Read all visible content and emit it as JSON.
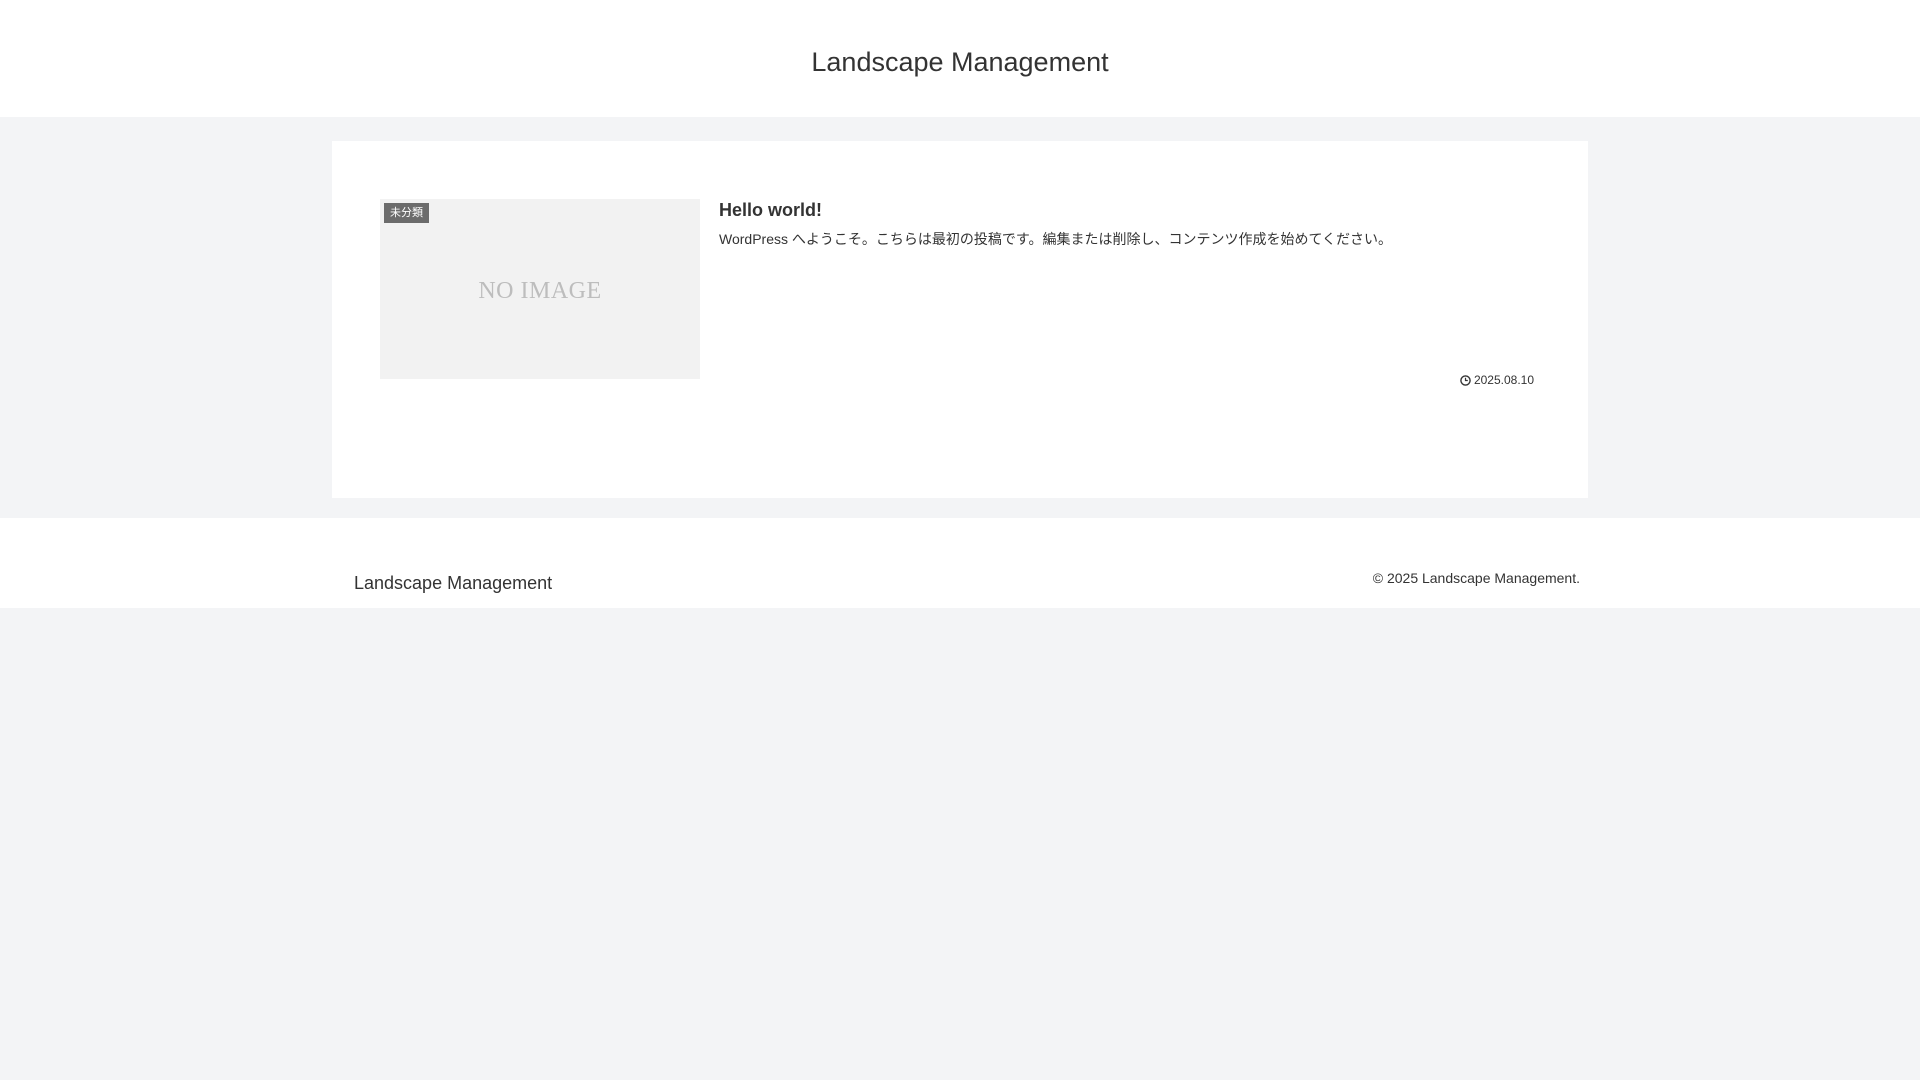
{
  "header": {
    "site_title": "Landscape Management"
  },
  "entry": {
    "thumbnail_text": "NO IMAGE",
    "category": "未分類",
    "title": "Hello world!",
    "snippet": "WordPress へようこそ。こちらは最初の投稿です。編集または削除し、コンテンツ作成を始めてください。",
    "date": "2025.08.10",
    "date_icon": "clock-icon"
  },
  "footer": {
    "site_title": "Landscape Management",
    "copyright": "© 2025 Landscape Management."
  },
  "colors": {
    "page_background": "#f3f4f6",
    "card_background": "#ffffff",
    "thumbnail_background": "#f2f2f2",
    "category_background": "#555555",
    "text": "#333333"
  }
}
